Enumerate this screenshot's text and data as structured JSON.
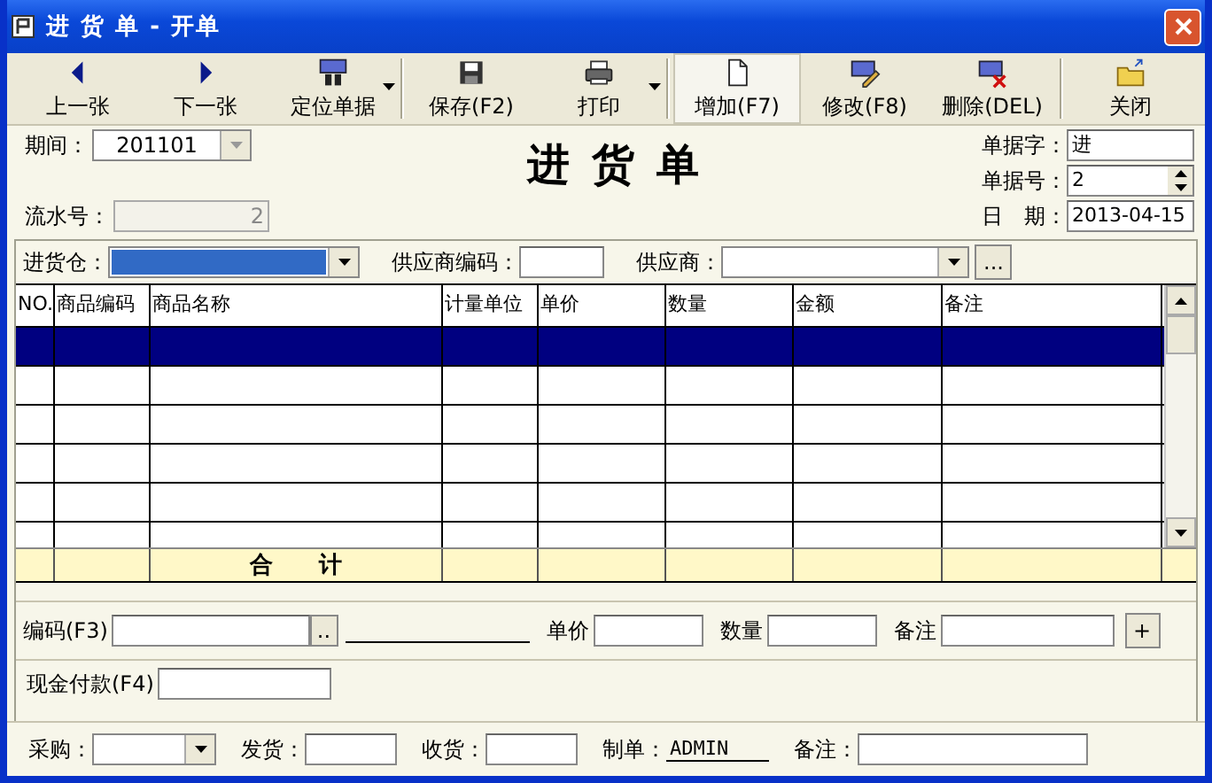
{
  "window": {
    "title": "进 货 单 - 开单"
  },
  "toolbar": [
    {
      "label": "上一张",
      "kind": "left",
      "dropdown": false,
      "selected": false
    },
    {
      "label": "下一张",
      "kind": "right",
      "dropdown": false,
      "selected": false
    },
    {
      "label": "定位单据",
      "kind": "locate",
      "dropdown": true,
      "selected": false
    },
    {
      "label": "保存(F2)",
      "kind": "save",
      "dropdown": false,
      "selected": false
    },
    {
      "label": "打印",
      "kind": "print",
      "dropdown": true,
      "selected": false
    },
    {
      "label": "增加(F7)",
      "kind": "new",
      "dropdown": false,
      "selected": true
    },
    {
      "label": "修改(F8)",
      "kind": "edit",
      "dropdown": false,
      "selected": false
    },
    {
      "label": "删除(DEL)",
      "kind": "delete",
      "dropdown": false,
      "selected": false
    },
    {
      "label": "关闭",
      "kind": "close",
      "dropdown": false,
      "selected": false
    }
  ],
  "header": {
    "title": "进 货 单",
    "period": {
      "label": "期间：",
      "value": "201101"
    },
    "serial": {
      "label": "流水号：",
      "value": "2",
      "disabled": true
    },
    "doc_word": {
      "label": "单据字：",
      "value": "进"
    },
    "doc_no": {
      "label": "单据号：",
      "value": "2"
    },
    "date": {
      "label": "日　期：",
      "value": "2013-04-15"
    }
  },
  "filters": {
    "warehouse": {
      "label": "进货仓：",
      "focused": true
    },
    "supplier_code": {
      "label": "供应商编码："
    },
    "supplier": {
      "label": "供应商：",
      "button": "..."
    }
  },
  "table": {
    "columns": [
      "NO.",
      "商品编码",
      "商品名称",
      "计量单位",
      "单价",
      "数量",
      "金额",
      "备注"
    ],
    "rows": [
      {
        "selected": true
      },
      {
        "selected": false
      },
      {
        "selected": false
      },
      {
        "selected": false
      },
      {
        "selected": false
      },
      {
        "selected": false
      }
    ],
    "total": {
      "label": "合　　计"
    }
  },
  "entry": {
    "code_label": "编码(F3)",
    "code_button": "..",
    "price_label": "单价",
    "qty_label": "数量",
    "note_label": "备注",
    "add_button": "+"
  },
  "cash": {
    "label": "现金付款(F4)"
  },
  "footer": {
    "purchase": "采购：",
    "ship": "发货：",
    "receive": "收货：",
    "maker": "制单：",
    "maker_value": "ADMIN",
    "note": "备注："
  }
}
